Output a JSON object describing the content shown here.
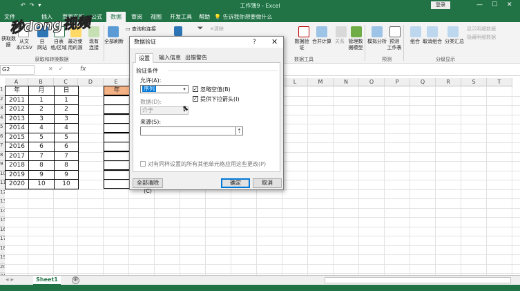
{
  "window": {
    "title": "工作簿9 - Excel",
    "login_label": "登录",
    "window_controls": [
      "—",
      "☐",
      "✕"
    ],
    "quick_access": [
      "↶",
      "↷",
      "▾"
    ]
  },
  "tabs": [
    {
      "label": "文件",
      "active": false
    },
    {
      "label": "插入",
      "active": false
    },
    {
      "label": "页面布局",
      "active": false
    },
    {
      "label": "公式",
      "active": false
    },
    {
      "label": "数据",
      "active": true
    },
    {
      "label": "审阅",
      "active": false
    },
    {
      "label": "视图",
      "active": false
    },
    {
      "label": "开发工具",
      "active": false
    },
    {
      "label": "帮助",
      "active": false
    }
  ],
  "tell_me": "告诉我你想要做什么",
  "watermark": "秒dong视频",
  "ribbon": {
    "get_data": [
      {
        "label": "获取数\n据"
      },
      {
        "label": "从文\n本/CSV"
      },
      {
        "label": "自\n网站"
      },
      {
        "label": "自表\n格/区域"
      },
      {
        "label": "最近使\n用的源"
      },
      {
        "label": "现有\n连接"
      }
    ],
    "get_group_label": "获取和转换数据",
    "refresh_all": "全部刷新",
    "queries_label": "查询和连接",
    "clear_label": "清除",
    "data_tools": [
      {
        "label": "数据验\n证"
      },
      {
        "label": "合并计算"
      },
      {
        "label": "关系"
      },
      {
        "label": "管理数\n据模型"
      }
    ],
    "data_tools_label": "数据工具",
    "forecast": [
      {
        "label": "模拟分析"
      },
      {
        "label": "预测\n工作表"
      }
    ],
    "forecast_label": "预测",
    "outline": [
      {
        "label": "组合"
      },
      {
        "label": "取消组合"
      },
      {
        "label": "分类汇总"
      }
    ],
    "outline_label": "分级显示",
    "show_detail": "显示明细数据",
    "hide_detail": "隐藏明细数据"
  },
  "formula_bar": {
    "name_box": "G2",
    "fx": "fx",
    "controls": "✕✓"
  },
  "columns": [
    "A",
    "B",
    "C",
    "D",
    "E",
    "F",
    "G",
    "H",
    "I",
    "J",
    "K",
    "L",
    "M",
    "N",
    "O",
    "P",
    "Q",
    "R",
    "S",
    "T"
  ],
  "row_numbers": [
    "1",
    "2",
    "3",
    "4",
    "5",
    "6",
    "7",
    "8",
    "9",
    "10",
    "11",
    "12",
    "13",
    "14",
    "15",
    "16",
    "17",
    "18",
    "19",
    "20",
    "21"
  ],
  "table": {
    "headers": [
      "年",
      "月",
      "日"
    ],
    "rows": [
      [
        "2011",
        "1",
        "1"
      ],
      [
        "2012",
        "2",
        "2"
      ],
      [
        "2013",
        "3",
        "3"
      ],
      [
        "2014",
        "4",
        "4"
      ],
      [
        "2015",
        "5",
        "5"
      ],
      [
        "2016",
        "6",
        "6"
      ],
      [
        "2017",
        "7",
        "7"
      ],
      [
        "2018",
        "8",
        "8"
      ],
      [
        "2019",
        "9",
        "9"
      ],
      [
        "2020",
        "10",
        "10"
      ]
    ]
  },
  "e_header": "年",
  "sheets": [
    {
      "label": "Sheet1"
    }
  ],
  "add_sheet": "⊕",
  "dialog": {
    "title": "数据验证",
    "help": "?",
    "close": "✕",
    "tabs": [
      {
        "label": "设置",
        "active": true
      },
      {
        "label": "输入信息",
        "active": false
      },
      {
        "label": "出错警告",
        "active": false
      }
    ],
    "section_label": "验证条件",
    "allow_label": "允许(A):",
    "allow_value": "序列",
    "data_label": "数据(D):",
    "data_value": "介于",
    "ignore_blank": "忽略空值(B)",
    "dropdown_in_cell": "提供下拉箭头(I)",
    "source_label": "来源(S):",
    "source_value": "",
    "apply_all": "对有同样设置的所有其他单元格应用这些更改(P)",
    "clear_all": "全部清除(C)",
    "ok": "确定",
    "cancel": "取消"
  }
}
